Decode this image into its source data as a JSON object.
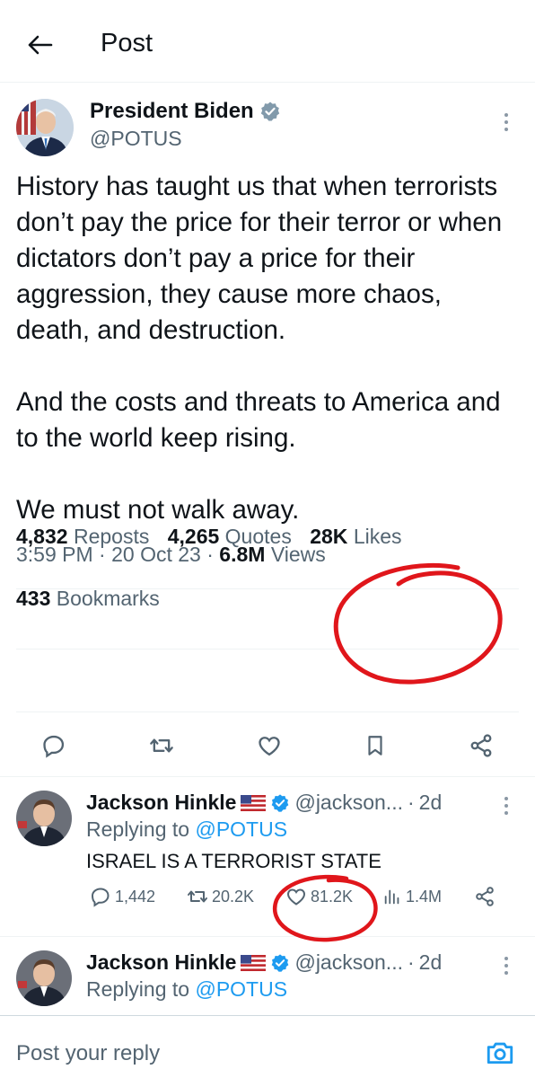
{
  "header": {
    "title": "Post"
  },
  "tweet": {
    "author_name": "President Biden",
    "author_handle": "@POTUS",
    "paragraphs": [
      "History has taught us that when terrorists don’t pay the price for their terror or when dictators don’t pay a price for their aggression, they cause more chaos, death, and destruction.",
      "And the costs and threats to America and to the world keep rising.",
      "We must not walk away."
    ],
    "time": "3:59 PM",
    "date": "20 Oct 23",
    "views_count": "6.8M",
    "views_label": "Views",
    "reposts_count": "4,832",
    "reposts_label": "Reposts",
    "quotes_count": "4,265",
    "quotes_label": "Quotes",
    "likes_count": "28K",
    "likes_label": "Likes",
    "bookmarks_count": "433",
    "bookmarks_label": "Bookmarks"
  },
  "replies": [
    {
      "name": "Jackson Hinkle",
      "handle": "@jackson...",
      "age": "2d",
      "replying_prefix": "Replying to",
      "replying_to": "@POTUS",
      "text": "ISRAEL IS A TERRORIST STATE",
      "comments": "1,442",
      "reposts": "20.2K",
      "likes": "81.2K",
      "views": "1.4M"
    },
    {
      "name": "Jackson Hinkle",
      "handle": "@jackson...",
      "age": "2d",
      "replying_prefix": "Replying to",
      "replying_to": "@POTUS"
    }
  ],
  "composer": {
    "placeholder": "Post your reply"
  },
  "colors": {
    "accent": "#1d9bf0",
    "annotation": "#e0161b",
    "muted": "#536471"
  },
  "icons": [
    "back-arrow-icon",
    "verified-badge-icon",
    "more-vertical-icon",
    "reply-icon",
    "repost-icon",
    "like-icon",
    "bookmark-icon",
    "share-icon",
    "views-icon",
    "camera-icon",
    "us-flag-icon"
  ]
}
